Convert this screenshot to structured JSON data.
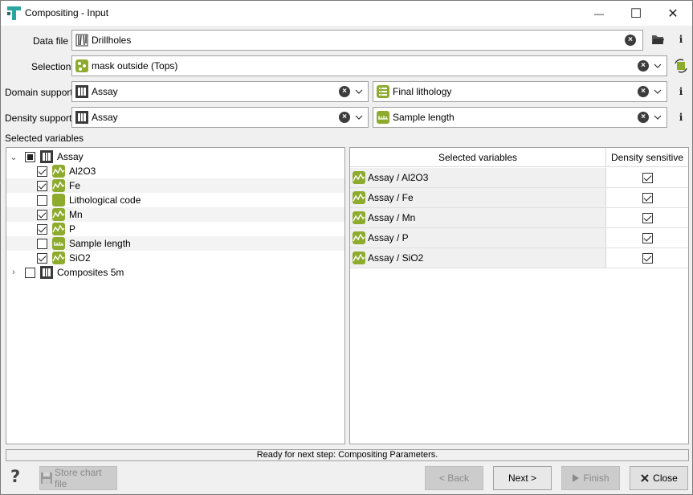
{
  "window": {
    "title": "Compositing - Input",
    "controls": {
      "minimize": "—",
      "maximize": "☐",
      "close": "✕"
    }
  },
  "form": {
    "data_file": {
      "label": "Data file",
      "value": "Drillholes",
      "icon": "drillhole-icon"
    },
    "selection": {
      "label": "Selection",
      "value": "mask outside (Tops)",
      "icon": "selection-mask-icon"
    },
    "domain_support": {
      "label": "Domain support",
      "value": "Assay",
      "icon": "points-file-icon",
      "second_value": "Final lithology",
      "second_icon": "categorical-variable-icon"
    },
    "density_support": {
      "label": "Density support",
      "value": "Assay",
      "icon": "points-file-icon",
      "second_value": "Sample length",
      "second_icon": "length-variable-icon"
    },
    "info_glyph": "i"
  },
  "variables": {
    "section_label": "Selected variables",
    "tree": [
      {
        "label": "Assay",
        "level": 0,
        "state": "partial",
        "expanded": true,
        "icon": "points-file-icon"
      },
      {
        "label": "Al2O3",
        "level": 1,
        "state": "checked",
        "icon": "numeric-variable-icon"
      },
      {
        "label": "Fe",
        "level": 1,
        "state": "checked",
        "icon": "numeric-variable-icon"
      },
      {
        "label": "Lithological code",
        "level": 1,
        "state": "unchecked",
        "icon": "categorical-variable-icon"
      },
      {
        "label": "Mn",
        "level": 1,
        "state": "checked",
        "icon": "numeric-variable-icon"
      },
      {
        "label": "P",
        "level": 1,
        "state": "checked",
        "icon": "numeric-variable-icon"
      },
      {
        "label": "Sample length",
        "level": 1,
        "state": "unchecked",
        "icon": "length-variable-icon"
      },
      {
        "label": "SiO2",
        "level": 1,
        "state": "checked",
        "icon": "numeric-variable-icon"
      },
      {
        "label": "Composites 5m",
        "level": 0,
        "state": "unchecked",
        "expanded": false,
        "icon": "points-file-icon"
      }
    ],
    "table": {
      "columns": [
        "Selected variables",
        "Density sensitive"
      ],
      "rows": [
        {
          "name": "Assay / Al2O3",
          "density_sensitive": true
        },
        {
          "name": "Assay / Fe",
          "density_sensitive": true
        },
        {
          "name": "Assay / Mn",
          "density_sensitive": true
        },
        {
          "name": "Assay / P",
          "density_sensitive": true
        },
        {
          "name": "Assay / SiO2",
          "density_sensitive": true
        }
      ]
    }
  },
  "status": "Ready for next step: Compositing Parameters.",
  "buttons": {
    "help": "?",
    "store_chart": "Store chart file",
    "back": "< Back",
    "next": "Next >",
    "finish": "Finish",
    "close": "Close"
  },
  "colors": {
    "accent_green": "#8dab2d",
    "brand_teal": "#2aa5a0"
  }
}
